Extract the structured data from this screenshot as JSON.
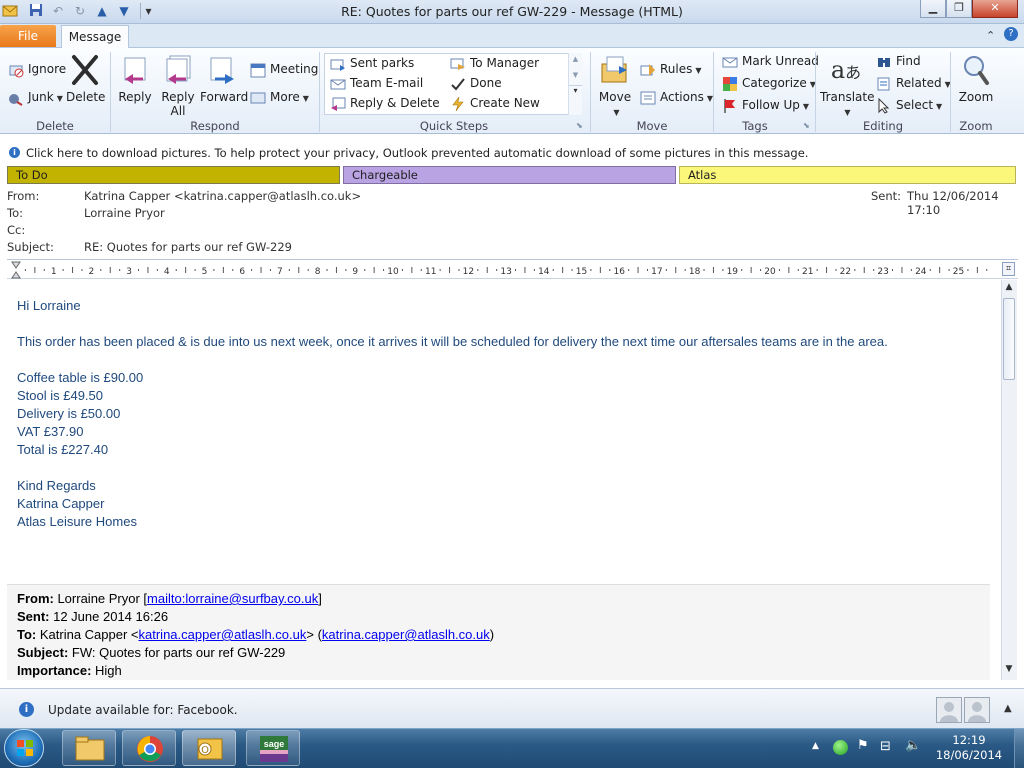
{
  "window": {
    "title": "RE: Quotes for parts our ref GW-229  -  Message (HTML)"
  },
  "tabs": {
    "file": "File",
    "message": "Message"
  },
  "ribbon": {
    "delete_group": {
      "label": "Delete",
      "ignore": "Ignore",
      "junk": "Junk",
      "delete": "Delete"
    },
    "respond_group": {
      "label": "Respond",
      "reply": "Reply",
      "reply_all_1": "Reply",
      "reply_all_2": "All",
      "forward": "Forward",
      "meeting": "Meeting",
      "more": "More"
    },
    "quicksteps_group": {
      "label": "Quick Steps",
      "items": [
        "Sent parks",
        "To Manager",
        "Team E-mail",
        "Done",
        "Reply & Delete",
        "Create New"
      ]
    },
    "move_group": {
      "label": "Move",
      "move": "Move",
      "rules": "Rules",
      "actions": "Actions"
    },
    "tags_group": {
      "label": "Tags",
      "mark_unread": "Mark Unread",
      "categorize": "Categorize",
      "follow_up": "Follow Up"
    },
    "editing_group": {
      "label": "Editing",
      "translate": "Translate",
      "find": "Find",
      "related": "Related",
      "select": "Select"
    },
    "zoom_group": {
      "label": "Zoom",
      "zoom": "Zoom"
    }
  },
  "infobar": {
    "text": "Click here to download pictures. To help protect your privacy, Outlook prevented automatic download of some pictures in this message."
  },
  "categories": [
    {
      "name": "To Do",
      "color": "#c1b300"
    },
    {
      "name": "Chargeable",
      "color": "#b9a3e3"
    },
    {
      "name": "Atlas",
      "color": "#fbf77b"
    }
  ],
  "header": {
    "from_label": "From:",
    "from_value": "Katrina Capper <katrina.capper@atlaslh.co.uk>",
    "to_label": "To:",
    "to_value": "Lorraine Pryor",
    "cc_label": "Cc:",
    "subject_label": "Subject:",
    "subject_value": "RE: Quotes for parts our ref GW-229",
    "sent_label": "Sent:",
    "sent_value": "Thu 12/06/2014 17:10"
  },
  "ruler": {
    "numbers": [
      "1",
      "2",
      "3",
      "4",
      "5",
      "6",
      "7",
      "8",
      "9",
      "10",
      "11",
      "12",
      "13",
      "14",
      "15",
      "16",
      "17",
      "18",
      "19",
      "20",
      "21",
      "22",
      "23",
      "24",
      "25"
    ]
  },
  "body": {
    "greeting": "Hi Lorraine",
    "para": "This order has been placed & is due into us next week, once it arrives it will be scheduled for delivery the next time our aftersales teams are in the area.",
    "items": [
      "Coffee table is £90.00",
      "Stool is £49.50",
      "Delivery is £50.00",
      "VAT £37.90",
      "Total is £227.40"
    ],
    "signoff": [
      "Kind Regards",
      "Katrina Capper",
      "Atlas Leisure Homes"
    ]
  },
  "quoted": {
    "from_label": "From:",
    "from_name": " Lorraine Pryor [",
    "from_link": "mailto:lorraine@surfbay.co.uk",
    "from_end": "]",
    "sent_label": "Sent:",
    "sent_value": " 12 June 2014 16:26",
    "to_label": "To:",
    "to_name": " Katrina Capper <",
    "to_link1": "katrina.capper@atlaslh.co.uk",
    "to_mid": "> (",
    "to_link2": "katrina.capper@atlaslh.co.uk",
    "to_end": ")",
    "subject_label": "Subject:",
    "subject_value": " FW: Quotes for parts our ref GW-229",
    "importance_label": "Importance:",
    "importance_value": " High"
  },
  "peoplebar": {
    "text": "Update available for: Facebook."
  },
  "taskbar": {
    "time": "12:19",
    "date": "18/06/2014"
  }
}
